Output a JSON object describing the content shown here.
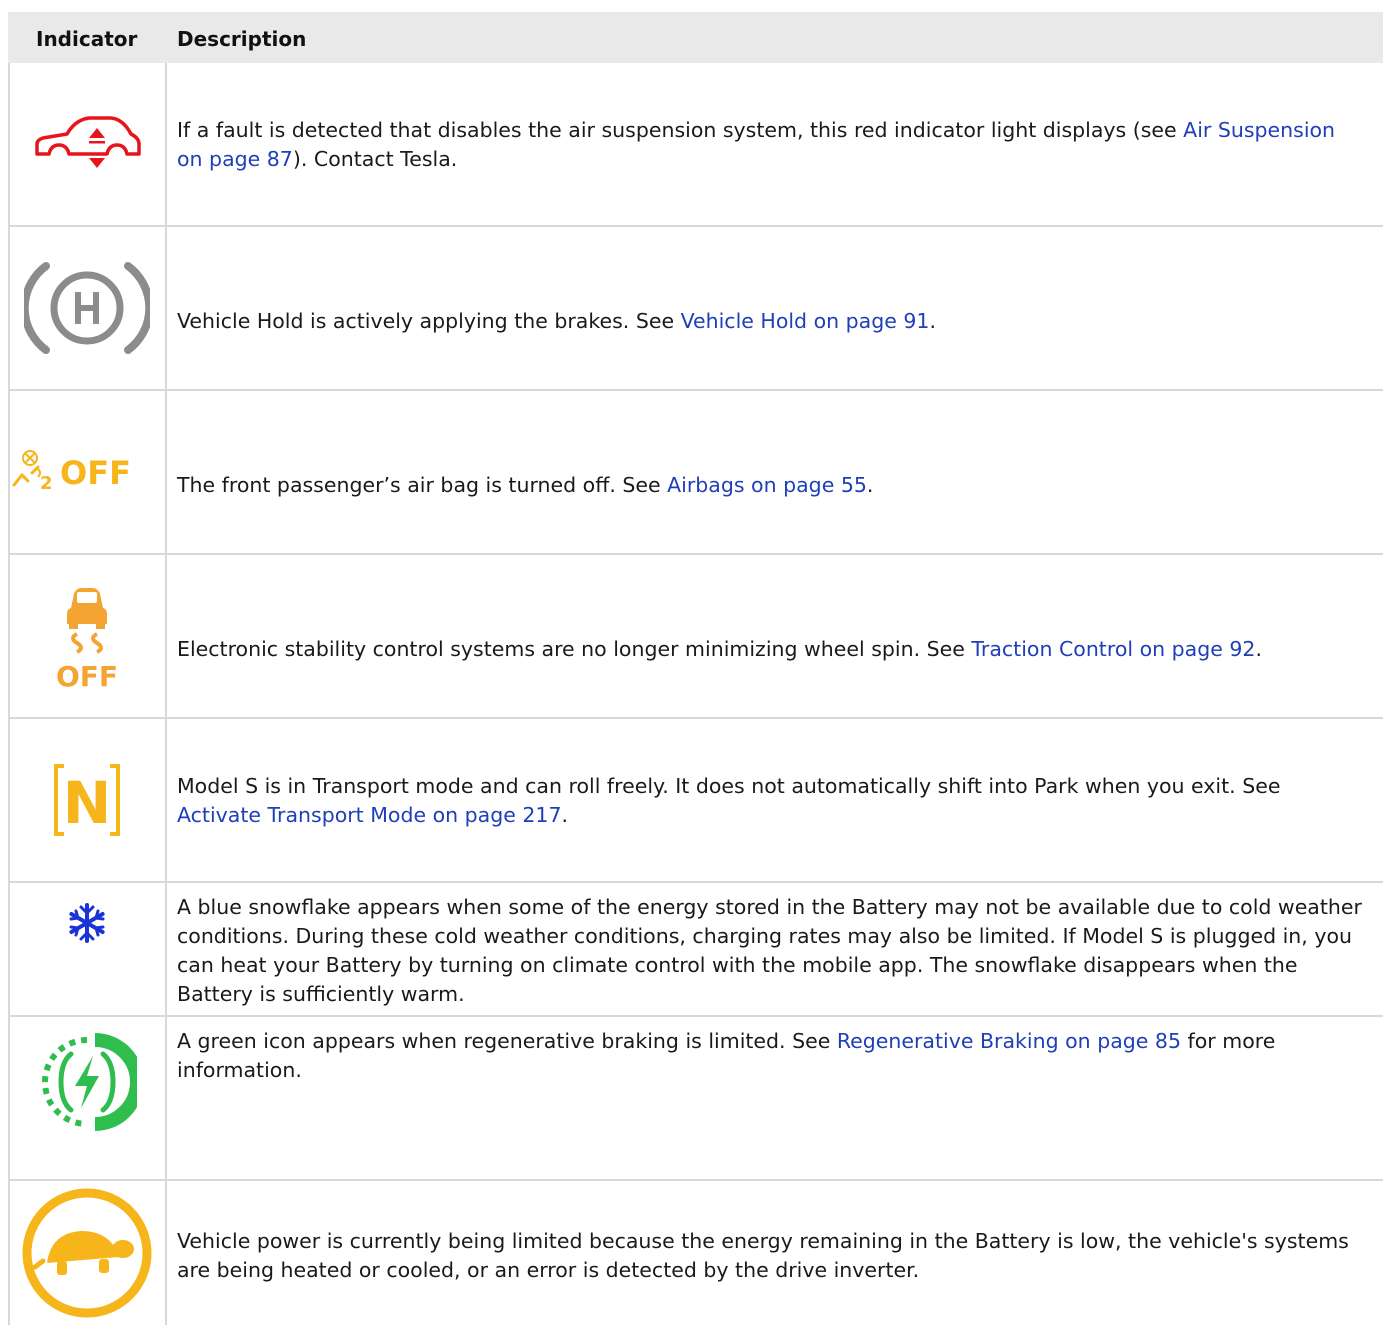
{
  "header": {
    "indicator": "Indicator",
    "description": "Description"
  },
  "colors": {
    "link": "#1f3fb8",
    "red": "#e8141c",
    "gray": "#8c8c8c",
    "amber": "#f7b51c",
    "orange": "#f4a432",
    "blue": "#1a33d6",
    "green": "#2fbe4e"
  },
  "rows": [
    {
      "icon": "air-suspension-fault-icon",
      "pre": "If a fault is detected that disables the air suspension system, this red indicator light displays (see ",
      "link": "Air Suspension on page 87",
      "post": "). Contact Tesla."
    },
    {
      "icon": "vehicle-hold-icon",
      "pre": "Vehicle Hold is actively applying the brakes. See ",
      "link": "Vehicle Hold on page 91",
      "post": "."
    },
    {
      "icon": "passenger-airbag-off-icon",
      "icon_text": "OFF",
      "pre": "The front passenger’s air bag is turned off. See ",
      "link": "Airbags on page 55",
      "post": "."
    },
    {
      "icon": "traction-control-off-icon",
      "icon_text": "OFF",
      "pre": "Electronic stability control systems are no longer minimizing wheel spin. See ",
      "link": "Traction Control on page 92",
      "post": "."
    },
    {
      "icon": "transport-mode-icon",
      "icon_text": "N",
      "pre": "Model S is in Transport mode and can roll freely. It does not automatically shift into Park when you exit. See ",
      "link": "Activate Transport Mode on page 217",
      "post": "."
    },
    {
      "icon": "snowflake-icon",
      "pre": "A blue snowflake appears when some of the energy stored in the Battery may not be available due to cold weather conditions. During these cold weather conditions, charging rates may also be limited. If Model S is plugged in, you can heat your Battery by turning on climate control with the mobile app. The snowflake disappears when the Battery is sufficiently warm.",
      "link": "",
      "post": ""
    },
    {
      "icon": "regen-braking-limited-icon",
      "pre": "A green icon appears when regenerative braking is limited. See ",
      "link": "Regenerative Braking on page 85",
      "post": " for more information."
    },
    {
      "icon": "power-limited-turtle-icon",
      "pre": "Vehicle power is currently being limited because the energy remaining in the Battery is low, the vehicle's systems are being heated or cooled, or an error is detected by the drive inverter.",
      "link": "",
      "post": ""
    }
  ]
}
